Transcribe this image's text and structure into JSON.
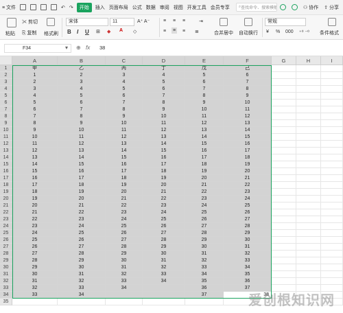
{
  "menubar": {
    "file_label": "文件",
    "tabs": [
      "开始",
      "插入",
      "页面布局",
      "公式",
      "数据",
      "审阅",
      "视图",
      "开发工具",
      "会员专享"
    ],
    "active_tab": "开始",
    "search_placeholder": "查找命令、搜索模板",
    "collab_label": "协作",
    "share_label": "分享"
  },
  "ribbon": {
    "paste_label": "粘贴",
    "cut_label": "剪切",
    "copy_label": "复制",
    "format_painter_label": "格式刷",
    "font_name": "宋体",
    "font_size": "11",
    "bold": "B",
    "italic": "I",
    "underline": "U",
    "merge_label": "合并居中",
    "wrap_label": "自动换行",
    "number_format": "常规",
    "currency_label": "¥",
    "percent_label": "%",
    "thousand_label": "000",
    "conditional_label": "条件格式"
  },
  "formula_bar": {
    "cell_ref": "F34",
    "fx_label": "fx",
    "value": "38"
  },
  "sheet": {
    "columns": [
      "A",
      "B",
      "C",
      "D",
      "E",
      "F",
      "G",
      "H",
      "I"
    ],
    "header_row": [
      "甲",
      "乙",
      "丙",
      "丁",
      "戊",
      "己"
    ],
    "columns_data": {
      "A": [
        "1",
        "2",
        "3",
        "4",
        "5",
        "6",
        "7",
        "8",
        "9",
        "10",
        "11",
        "12",
        "13",
        "14",
        "15",
        "16",
        "17",
        "18",
        "19",
        "20",
        "21",
        "22",
        "23",
        "24",
        "25",
        "26",
        "27",
        "28",
        "29",
        "30",
        "31",
        "32",
        "33"
      ],
      "B": [
        "2",
        "3",
        "4",
        "5",
        "6",
        "7",
        "8",
        "9",
        "10",
        "11",
        "12",
        "13",
        "14",
        "15",
        "16",
        "17",
        "18",
        "19",
        "20",
        "21",
        "22",
        "23",
        "24",
        "25",
        "26",
        "27",
        "28",
        "29",
        "30",
        "31",
        "32",
        "33",
        "34"
      ],
      "C": [
        "3",
        "4",
        "5",
        "6",
        "7",
        "8",
        "9",
        "10",
        "11",
        "12",
        "13",
        "14",
        "15",
        "16",
        "17",
        "18",
        "19",
        "20",
        "21",
        "22",
        "23",
        "24",
        "25",
        "26",
        "27",
        "28",
        "29",
        "30",
        "31",
        "32",
        "33",
        "34",
        ""
      ],
      "D": [
        "4",
        "5",
        "6",
        "7",
        "8",
        "9",
        "10",
        "11",
        "12",
        "13",
        "14",
        "15",
        "16",
        "17",
        "18",
        "19",
        "20",
        "21",
        "22",
        "23",
        "24",
        "25",
        "26",
        "27",
        "28",
        "29",
        "30",
        "31",
        "32",
        "33",
        "34",
        "",
        ""
      ],
      "E": [
        "5",
        "6",
        "7",
        "8",
        "9",
        "10",
        "11",
        "12",
        "13",
        "14",
        "15",
        "16",
        "17",
        "18",
        "19",
        "20",
        "21",
        "22",
        "23",
        "24",
        "25",
        "26",
        "27",
        "28",
        "29",
        "30",
        "31",
        "32",
        "33",
        "34",
        "35",
        "36",
        "37"
      ],
      "F": [
        "6",
        "7",
        "8",
        "9",
        "10",
        "11",
        "12",
        "13",
        "14",
        "15",
        "16",
        "17",
        "18",
        "19",
        "20",
        "21",
        "22",
        "23",
        "24",
        "25",
        "26",
        "27",
        "28",
        "29",
        "30",
        "31",
        "32",
        "33",
        "34",
        "35",
        "36",
        "37",
        "38"
      ]
    },
    "row_count": 35,
    "selection_color": "#1aa35e"
  },
  "watermark": "爱创根知识网"
}
